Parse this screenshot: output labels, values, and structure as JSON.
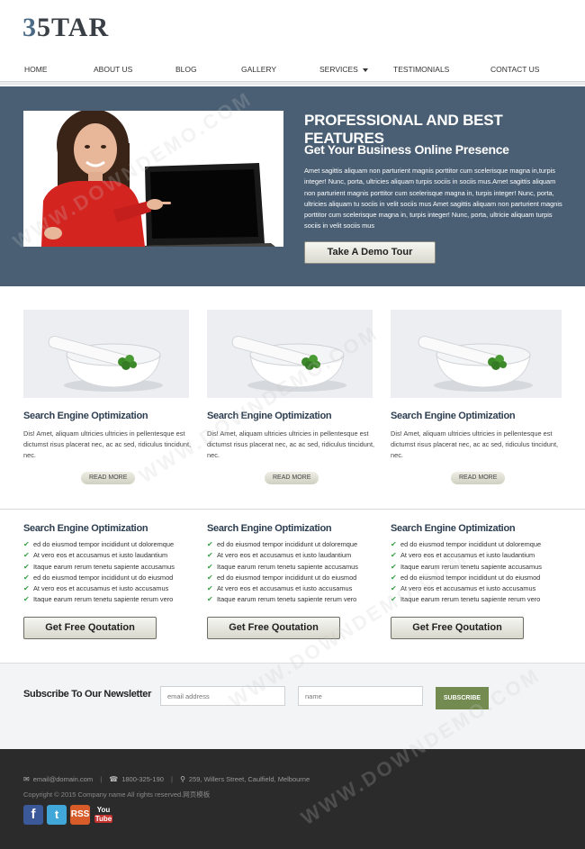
{
  "brand": {
    "logo_num": "3",
    "logo_text": "5TAR"
  },
  "nav": {
    "items": [
      {
        "label": "HOME"
      },
      {
        "label": "ABOUT US"
      },
      {
        "label": "BLOG"
      },
      {
        "label": "GALLERY"
      },
      {
        "label": "SERVICES"
      },
      {
        "label": "TESTIMONIALS"
      },
      {
        "label": "CONTACT US"
      }
    ]
  },
  "hero": {
    "title": "PROFESSIONAL AND BEST FEATURES",
    "subtitle": "Get Your Business Online Presence",
    "body": "Amet sagittis aliquam non parturient magnis porttitor cum scelerisque magna in,turpis integer! Nunc, porta, ultricies aliquam turpis sociis in sociis mus.Amet sagittis aliquam non parturient magnis porttitor cum scelerisque magna in, turpis integer! Nunc, porta, ultricies aliquam tu sociis in velit sociis mus Amet sagittis aliquam non parturient magnis porttitor cum scelerisque magna in, turpis integer! Nunc, porta, ultricie aliquam turpis sociis in velit sociis mus",
    "cta_label": "Take A Demo Tour"
  },
  "features": [
    {
      "title": "Search Engine Optimization",
      "text": "Dis! Amet, aliquam ultricies ultricies in pellentesque est dictumst risus placerat nec, ac ac sed, ridiculus tincidunt, nec.",
      "read_more": "READ MORE"
    },
    {
      "title": "Search Engine Optimization",
      "text": "Dis! Amet, aliquam ultricies ultricies in pellentesque est dictumst risus placerat nec, ac ac sed, ridiculus tincidunt, nec.",
      "read_more": "READ MORE"
    },
    {
      "title": "Search Engine Optimization",
      "text": "Dis! Amet, aliquam ultricies ultricies in pellentesque est dictumst risus placerat nec, ac ac sed, ridiculus tincidunt, nec.",
      "read_more": "READ MORE"
    }
  ],
  "lists": [
    {
      "title": "Search Engine Optimization",
      "items": [
        "ed do eiusmod tempor incididunt ut doloremque",
        "At vero eos et accusamus et iusto laudantium",
        "Itaque earum rerum tenetu sapiente accusamus",
        "ed do eiusmod tempor incididunt ut do eiusmod",
        "At vero eos et accusamus et iusto accusamus",
        "Itaque earum rerum tenetu sapiente rerum vero"
      ],
      "button": "Get Free Qoutation"
    },
    {
      "title": "Search Engine Optimization",
      "items": [
        "ed do eiusmod tempor incididunt ut doloremque",
        "At vero eos et accusamus et iusto laudantium",
        "Itaque earum rerum tenetu sapiente accusamus",
        "ed do eiusmod tempor incididunt ut do eiusmod",
        "At vero eos et accusamus et iusto accusamus",
        "Itaque earum rerum tenetu sapiente rerum vero"
      ],
      "button": "Get Free Qoutation"
    },
    {
      "title": "Search Engine Optimization",
      "items": [
        "ed do eiusmod tempor incididunt ut doloremque",
        "At vero eos et accusamus et iusto laudantium",
        "Itaque earum rerum tenetu sapiente accusamus",
        "ed do eiusmod tempor incididunt ut do eiusmod",
        "At vero eos et accusamus et iusto accusamus",
        "Itaque earum rerum tenetu sapiente rerum vero"
      ],
      "button": "Get Free Qoutation"
    }
  ],
  "newsletter": {
    "title": "Subscribe To Our Newsletter",
    "email_placeholder": "email address",
    "name_placeholder": "name",
    "button": "SUBSCRIBE"
  },
  "footer": {
    "email": "email@domain.com",
    "phone": "1800-325-190",
    "address": "259, Willers Street, Caulfield, Melbourne",
    "copyright": "Copyright © 2015 Company name All rights reserved.网页模板"
  },
  "social": [
    {
      "icon": "facebook-icon",
      "glyph": "f"
    },
    {
      "icon": "twitter-icon",
      "glyph": "t"
    },
    {
      "icon": "rss-icon",
      "glyph": "RSS"
    },
    {
      "icon": "youtube-icon",
      "glyph_top": "You",
      "glyph_bottom": "Tube"
    }
  ],
  "watermark": "WWW.DOWNDEMO.COM",
  "colors": {
    "hero_bg": "#4a5f74",
    "heading": "#2d3e50",
    "check": "#38a146",
    "subscribe": "#738b50",
    "footer_bg": "#2b2b2b"
  }
}
